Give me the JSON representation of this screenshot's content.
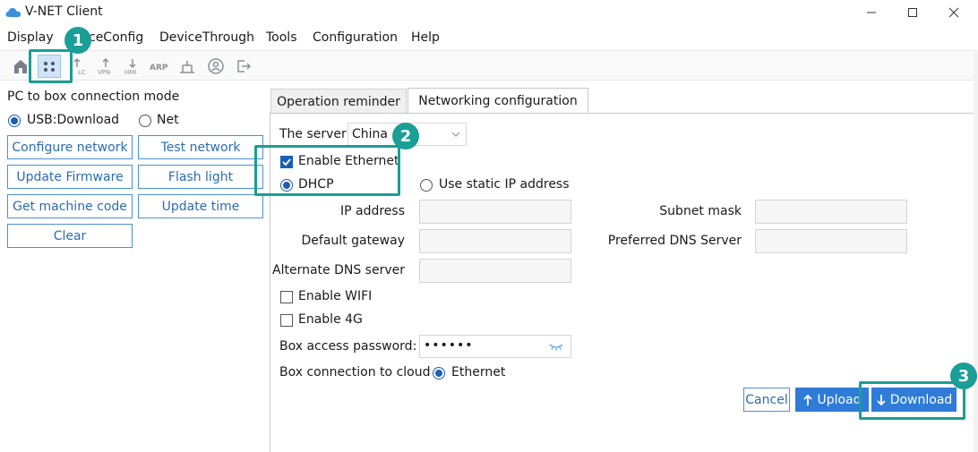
{
  "window": {
    "title": "V-NET Client",
    "accent_color": "#1a5fb4",
    "annotation_color": "#1a9e96"
  },
  "menu": {
    "items": [
      "Display",
      "ceConfig",
      "DeviceThrough",
      "Tools",
      "Configuration",
      "Help"
    ]
  },
  "toolbar": {
    "icons": [
      "home-icon",
      "device-grid-icon",
      "plc-upload-icon",
      "vpn-icon",
      "hmi-icon",
      "arp-icon",
      "network-tool-icon",
      "user-icon",
      "exit-icon"
    ],
    "labels": {
      "plc": "LC",
      "vpn": "VPN",
      "hmi": "HMI",
      "arp": "ARP"
    }
  },
  "left_panel": {
    "mode_label": "PC to box connection mode",
    "mode_usb": "USB:Download",
    "mode_net": "Net",
    "selected_mode": "USB:Download",
    "buttons": {
      "configure_network": "Configure network",
      "test_network": "Test network",
      "update_firmware": "Update Firmware",
      "flash_light": "Flash light",
      "get_machine_code": "Get machine code",
      "update_time": "Update time",
      "clear": "Clear"
    }
  },
  "tabs": {
    "reminder": "Operation reminder",
    "networking": "Networking configuration",
    "active": "Networking configuration"
  },
  "form": {
    "server_label": "The server:",
    "server_value": "China",
    "enable_ethernet": "Enable Ethernet",
    "enable_ethernet_checked": true,
    "dhcp": "DHCP",
    "static_ip": "Use static IP address",
    "ip_address_label": "IP address",
    "subnet_mask_label": "Subnet mask",
    "default_gateway_label": "Default gateway",
    "preferred_dns_label": "Preferred DNS Server",
    "alternate_dns_label": "Alternate DNS server",
    "enable_wifi": "Enable WIFI",
    "enable_4g": "Enable 4G",
    "password_label": "Box access password:",
    "password_value": "••••••",
    "cloud_label": "Box connection to cloud",
    "cloud_option": "Ethernet"
  },
  "actions": {
    "cancel": "Cancel",
    "upload": "Upload",
    "download": "Download"
  },
  "badges": {
    "one": "1",
    "two": "2",
    "three": "3"
  }
}
